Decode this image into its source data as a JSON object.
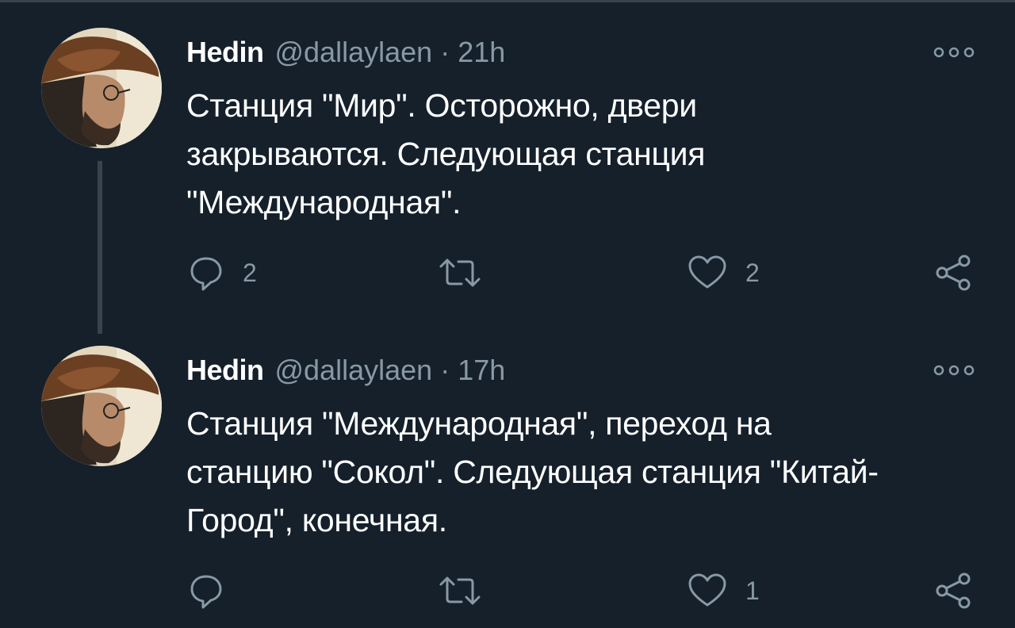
{
  "tweets": [
    {
      "author_name": "Hedin",
      "handle": "@dallaylaen",
      "separator": "·",
      "time": "21h",
      "text": "Станция \"Мир\". Осторожно, двери закрываются. Следующая станция \"Международная\".",
      "reply_count": "2",
      "retweet_count": "",
      "like_count": "2"
    },
    {
      "author_name": "Hedin",
      "handle": "@dallaylaen",
      "separator": "·",
      "time": "17h",
      "text": "Станция \"Международная\", переход на станцию \"Сокол\". Следующая станция \"Китай-Город\", конечная.",
      "reply_count": "",
      "retweet_count": "",
      "like_count": "1"
    }
  ],
  "icons": {
    "reply": "reply-icon",
    "retweet": "retweet-icon",
    "like": "heart-icon",
    "share": "share-icon",
    "more": "more-options-icon"
  },
  "colors": {
    "background": "#15202b",
    "muted": "#8899a6",
    "thread_line": "#38444d",
    "text": "#ffffff"
  }
}
